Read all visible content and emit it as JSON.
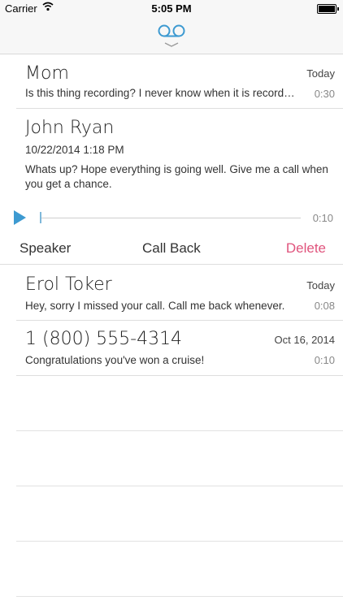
{
  "status_bar": {
    "carrier": "Carrier",
    "time": "5:05 PM"
  },
  "nav": {
    "icon": "voicemail-icon",
    "accent": "#3d9ad1"
  },
  "voicemails": [
    {
      "name": "Mom",
      "date": "Today",
      "message": "Is this thing recording? I never know when it is recording.",
      "duration": "0:30"
    },
    {
      "name": "Erol Toker",
      "date": "Today",
      "message": "Hey, sorry I missed your call. Call me back whenever.",
      "duration": "0:08"
    },
    {
      "name": "1 (800) 555-4314",
      "date": "Oct 16, 2014",
      "message": "Congratulations you've won a cruise!",
      "duration": "0:10"
    }
  ],
  "expanded": {
    "name": "John Ryan",
    "datetime": "10/22/2014 1:18 PM",
    "message_line1": "Whats up? Hope everything is going well. Give me a call when",
    "message_line2": "you get a chance.",
    "duration": "0:10",
    "progress": 0,
    "speaker_label": "Speaker",
    "call_back_label": "Call Back",
    "delete_label": "Delete",
    "delete_color": "#e0547d"
  }
}
